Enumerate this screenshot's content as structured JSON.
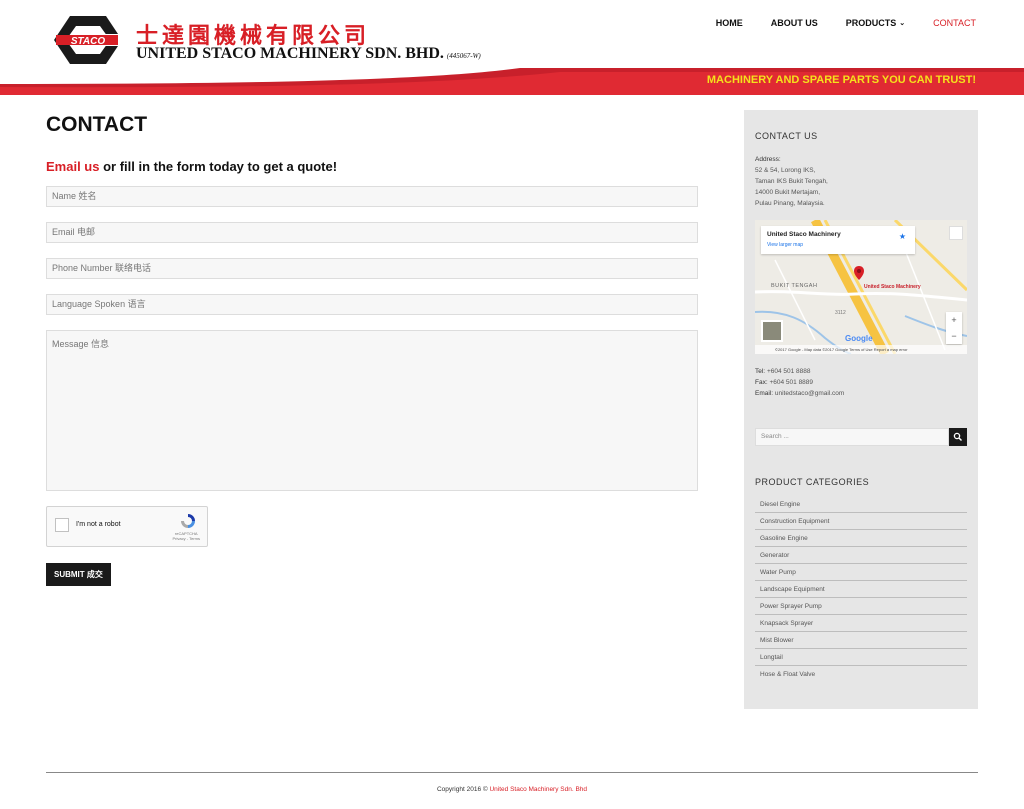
{
  "header": {
    "logo_chinese": "士達園機械有限公司",
    "logo_english": "UNITED STACO MACHINERY SDN. BHD.",
    "logo_reg": "(445067-W)",
    "logo_mark_text": "STACO",
    "tagline": "MACHINERY AND SPARE PARTS YOU CAN TRUST!",
    "nav": [
      {
        "label": "HOME"
      },
      {
        "label": "ABOUT US"
      },
      {
        "label": "PRODUCTS"
      },
      {
        "label": "CONTACT"
      }
    ],
    "colors": {
      "brand_red": "#d81f26",
      "tagline_yellow": "#f5e11b"
    }
  },
  "main": {
    "title": "CONTACT",
    "quote_email": "Email us",
    "quote_rest": " or fill in the form today to get a quote!",
    "fields": {
      "name": "Name 姓名",
      "email": "Email 电邮",
      "phone": "Phone Number 联络电话",
      "language": "Language Spoken 语言",
      "message": "Message 信息"
    },
    "captcha_label": "I'm not a robot",
    "captcha_brand": "reCAPTCHA",
    "captcha_terms": "Privacy - Terms",
    "submit_label": "SUBMIT 成交"
  },
  "sidebar": {
    "contact_title": "CONTACT US",
    "address_label": "Address:",
    "address_lines": [
      "52 & 54, Lorong IKS,",
      "Taman IKS Bukit Tengah,",
      "14000 Bukit Mertajam,",
      "Pulau Pinang, Malaysia."
    ],
    "map": {
      "card_title": "United Staco Machinery",
      "card_link": "View larger map",
      "pin_label": "United Staco Machinery",
      "area_label": "BUKIT TENGAH",
      "road_label": "3112",
      "google": "Google",
      "footer": "©2017 Google - Map data ©2017 Google    Terms of Use    Report a map error"
    },
    "tel_label": "Tel:",
    "tel": "+604 501 8888",
    "fax_label": "Fax:",
    "fax": "+604 501 8889",
    "email_label": "Email:",
    "email": "unitedstaco@gmail.com",
    "search_placeholder": "Search ...",
    "categories_title": "PRODUCT CATEGORIES",
    "categories": [
      "Diesel Engine",
      "Construction Equipment",
      "Gasoline Engine",
      "Generator",
      "Water Pump",
      "Landscape Equipment",
      "Power Sprayer Pump",
      "Knapsack Sprayer",
      "Mist Blower",
      "Longtail",
      "Hose & Float Valve"
    ]
  },
  "footer": {
    "copyright": "Copyright 2016 © ",
    "company": "United Staco Machinery Sdn. Bhd"
  }
}
